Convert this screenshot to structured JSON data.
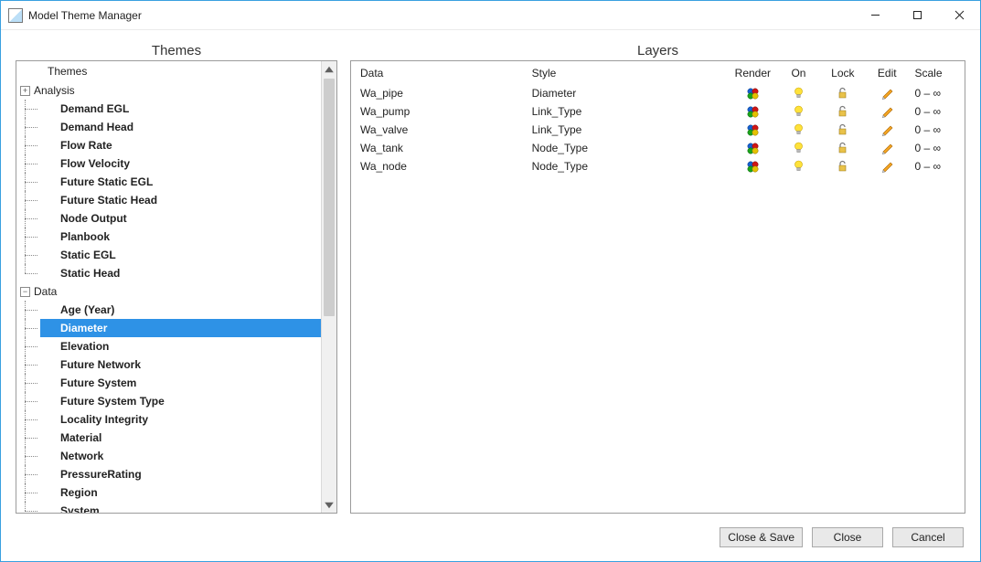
{
  "window": {
    "title": "Model Theme Manager"
  },
  "panels": {
    "themes_title": "Themes",
    "layers_title": "Layers"
  },
  "tree": {
    "header": "Themes",
    "groups": [
      {
        "label": "Analysis",
        "expanded": true,
        "expander_glyph": "⊞",
        "items": [
          "Demand EGL",
          "Demand Head",
          "Flow Rate",
          "Flow Velocity",
          "Future Static EGL",
          "Future Static Head",
          "Node Output",
          "Planbook",
          "Static EGL",
          "Static Head"
        ]
      },
      {
        "label": "Data",
        "expanded": true,
        "expander_glyph": "⊟",
        "items": [
          "Age (Year)",
          "Diameter",
          "Elevation",
          "Future Network",
          "Future System",
          "Future System Type",
          "Locality Integrity",
          "Material",
          "Network",
          "PressureRating",
          "Region",
          "System"
        ],
        "selected": "Diameter"
      }
    ]
  },
  "layers": {
    "columns": {
      "data": "Data",
      "style": "Style",
      "render": "Render",
      "on": "On",
      "lock": "Lock",
      "edit": "Edit",
      "scale": "Scale"
    },
    "rows": [
      {
        "data": "Wa_pipe",
        "style": "Diameter",
        "scale": "0 – ∞"
      },
      {
        "data": "Wa_pump",
        "style": "Link_Type",
        "scale": "0 – ∞"
      },
      {
        "data": "Wa_valve",
        "style": "Link_Type",
        "scale": "0 – ∞"
      },
      {
        "data": "Wa_tank",
        "style": "Node_Type",
        "scale": "0 – ∞"
      },
      {
        "data": "Wa_node",
        "style": "Node_Type",
        "scale": "0 – ∞"
      }
    ]
  },
  "buttons": {
    "close_save": "Close & Save",
    "close": "Close",
    "cancel": "Cancel"
  }
}
